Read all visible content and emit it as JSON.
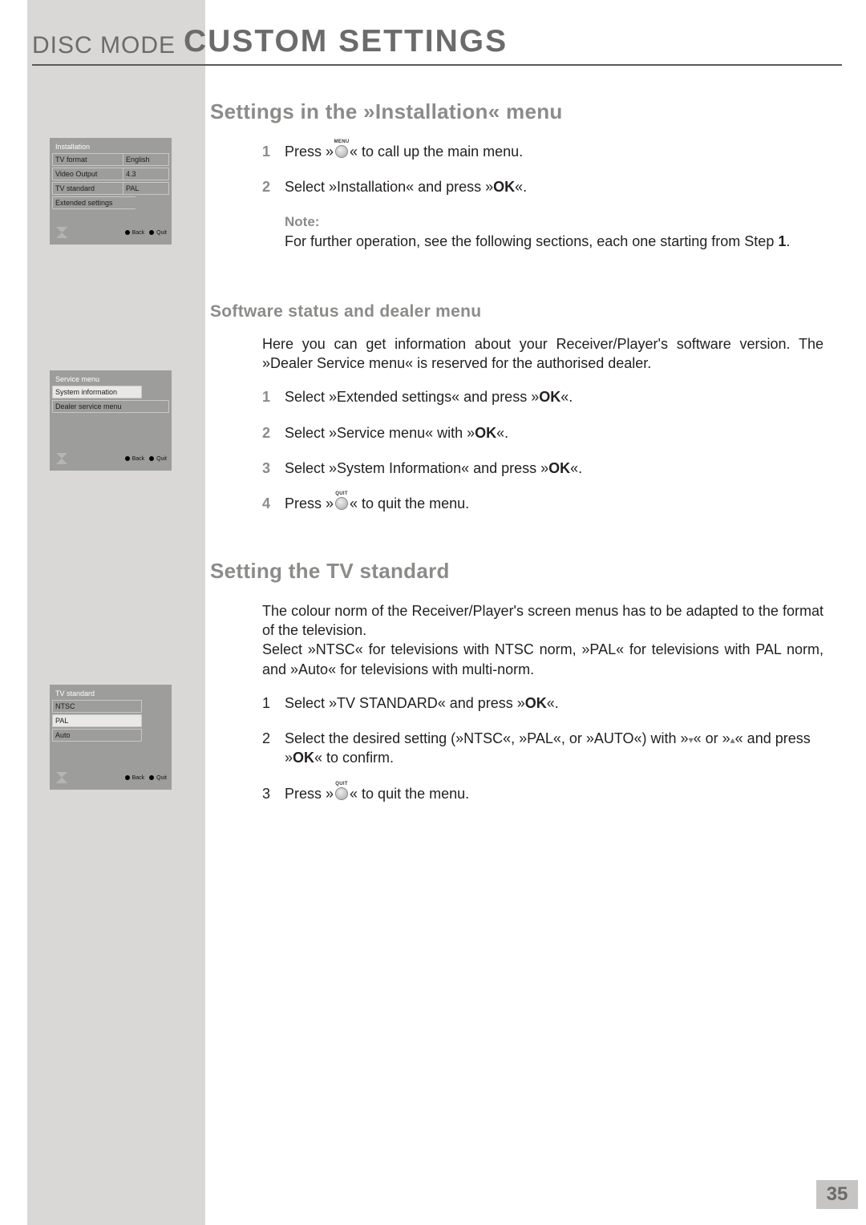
{
  "header": {
    "light": "DISC MODE",
    "bold": "CUSTOM SETTINGS"
  },
  "page_number": "35",
  "panel_installation": {
    "title": "Installation",
    "rows": [
      {
        "l": "TV format",
        "r": "English"
      },
      {
        "l": "Video Output",
        "r": "4.3"
      },
      {
        "l": "TV standard",
        "r": "PAL"
      },
      {
        "l": "Extended settings",
        "r": ""
      }
    ],
    "back": "Back",
    "quit": "Quit"
  },
  "panel_service": {
    "title": "Service menu",
    "rows": [
      {
        "t": "System information",
        "selected": true
      },
      {
        "t": "Dealer service menu",
        "selected": false
      }
    ],
    "back": "Back",
    "quit": "Quit"
  },
  "panel_tvstd": {
    "title": "TV standard",
    "rows": [
      {
        "t": "NTSC"
      },
      {
        "t": "PAL"
      },
      {
        "t": "Auto"
      }
    ],
    "back": "Back",
    "quit": "Quit"
  },
  "main": {
    "h2_1": "Settings in the »Installation« menu",
    "s1": {
      "n": "1",
      "pre": "Press »",
      "cap": "MENU",
      "post": "« to call up the main menu."
    },
    "s2": {
      "n": "2",
      "a": "Select »Installation« and press »",
      "ok": "OK",
      "b": "«."
    },
    "note_label": "Note:",
    "note_body_a": "For further operation, see the following sections, each one starting from Step ",
    "note_body_b": "1",
    "note_body_c": ".",
    "h3_1": "Software status and dealer menu",
    "p1": "Here you can get information about your Receiver/Player's software version. The »Dealer Service menu« is reserved for the authorised dealer.",
    "ss1": {
      "n": "1",
      "a": "Select »Extended settings« and press »",
      "ok": "OK",
      "b": "«."
    },
    "ss2": {
      "n": "2",
      "a": "Select »Service menu« with  »",
      "ok": "OK",
      "b": "«."
    },
    "ss3": {
      "n": "3",
      "a": "Select »System Information« and press »",
      "ok": "OK",
      "b": "«."
    },
    "ss4": {
      "n": "4",
      "pre": "Press »",
      "cap": "QUIT",
      "post": "« to quit the menu."
    },
    "h2_2": "Setting the TV standard",
    "p2a": "The colour norm of the Receiver/Player's screen menus has to be adapted to the format of the television.",
    "p2b": "Select »NTSC« for televisions with NTSC norm, »PAL« for televisions with PAL norm, and »Auto« for televisions with multi-norm.",
    "ts1": {
      "n": "1",
      "a": "Select »TV STANDARD« and press »",
      "ok": "OK",
      "b": "«."
    },
    "ts2": {
      "n": "2",
      "a": "Select the desired setting (»NTSC«, »PAL«, or »AUTO«) with »",
      "mid": "« or »",
      "b": "« and press »",
      "ok": "OK",
      "c": "« to confirm."
    },
    "ts3": {
      "n": "3",
      "pre": "Press »",
      "cap": "QUIT",
      "post": "« to quit the menu."
    }
  }
}
